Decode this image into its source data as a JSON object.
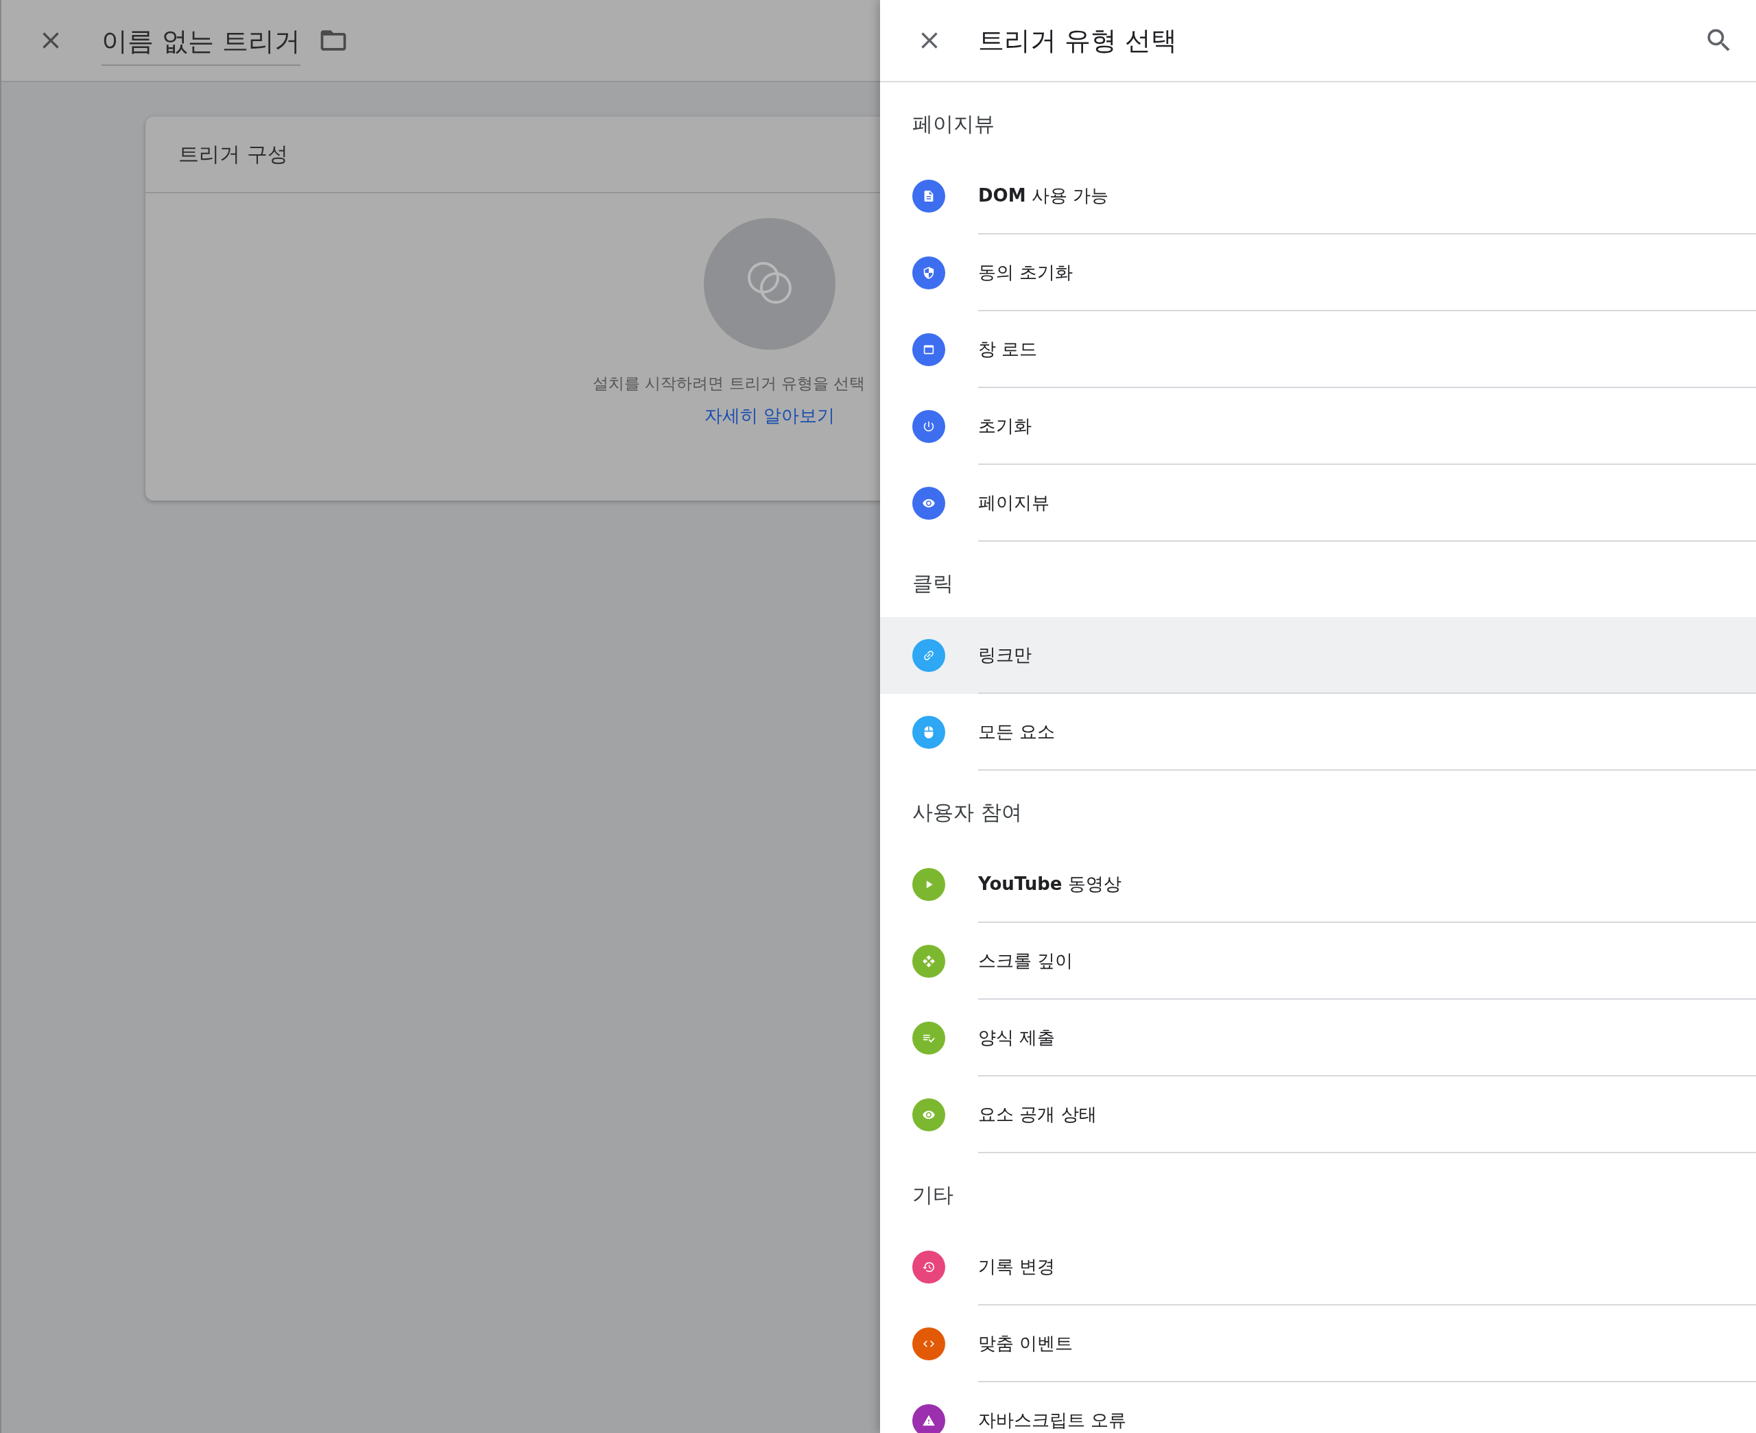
{
  "page": {
    "title": "이름 없는 트리거",
    "card": {
      "title": "트리거 구성",
      "message": "설치를 시작하려면 트리거 유형을 선택",
      "link": "자세히 알아보기"
    }
  },
  "panel": {
    "title": "트리거 유형 선택",
    "sections": [
      {
        "label": "페이지뷰",
        "items": [
          {
            "label": "**DOM** 사용 가능",
            "kind": "document",
            "color": "#3d6ef0",
            "selected": false
          },
          {
            "label": "동의 초기화",
            "kind": "shield",
            "color": "#3d6ef0",
            "selected": false
          },
          {
            "label": "창 로드",
            "kind": "window",
            "color": "#3d6ef0",
            "selected": false
          },
          {
            "label": "초기화",
            "kind": "power",
            "color": "#3d6ef0",
            "selected": false
          },
          {
            "label": "페이지뷰",
            "kind": "eye",
            "color": "#3d6ef0",
            "selected": false
          }
        ]
      },
      {
        "label": "클릭",
        "items": [
          {
            "label": "링크만",
            "kind": "link",
            "color": "#2ea7f4",
            "selected": true
          },
          {
            "label": "모든 요소",
            "kind": "mouse",
            "color": "#2ea7f4",
            "selected": false
          }
        ]
      },
      {
        "label": "사용자 참여",
        "items": [
          {
            "label": "**YouTube** 동영상",
            "kind": "play",
            "color": "#7cb82f",
            "selected": false
          },
          {
            "label": "스크롤 깊이",
            "kind": "move",
            "color": "#7cb82f",
            "selected": false
          },
          {
            "label": "양식 제출",
            "kind": "form",
            "color": "#7cb82f",
            "selected": false
          },
          {
            "label": "요소 공개 상태",
            "kind": "eye",
            "color": "#7cb82f",
            "selected": false
          }
        ]
      },
      {
        "label": "기타",
        "items": [
          {
            "label": "기록 변경",
            "kind": "history",
            "color": "#e8457c",
            "selected": false
          },
          {
            "label": "맞춤 이벤트",
            "kind": "code",
            "color": "#e35a06",
            "selected": false
          },
          {
            "label": "자바스크립트 오류",
            "kind": "warning",
            "color": "#9b2fae",
            "selected": false
          }
        ]
      }
    ]
  }
}
